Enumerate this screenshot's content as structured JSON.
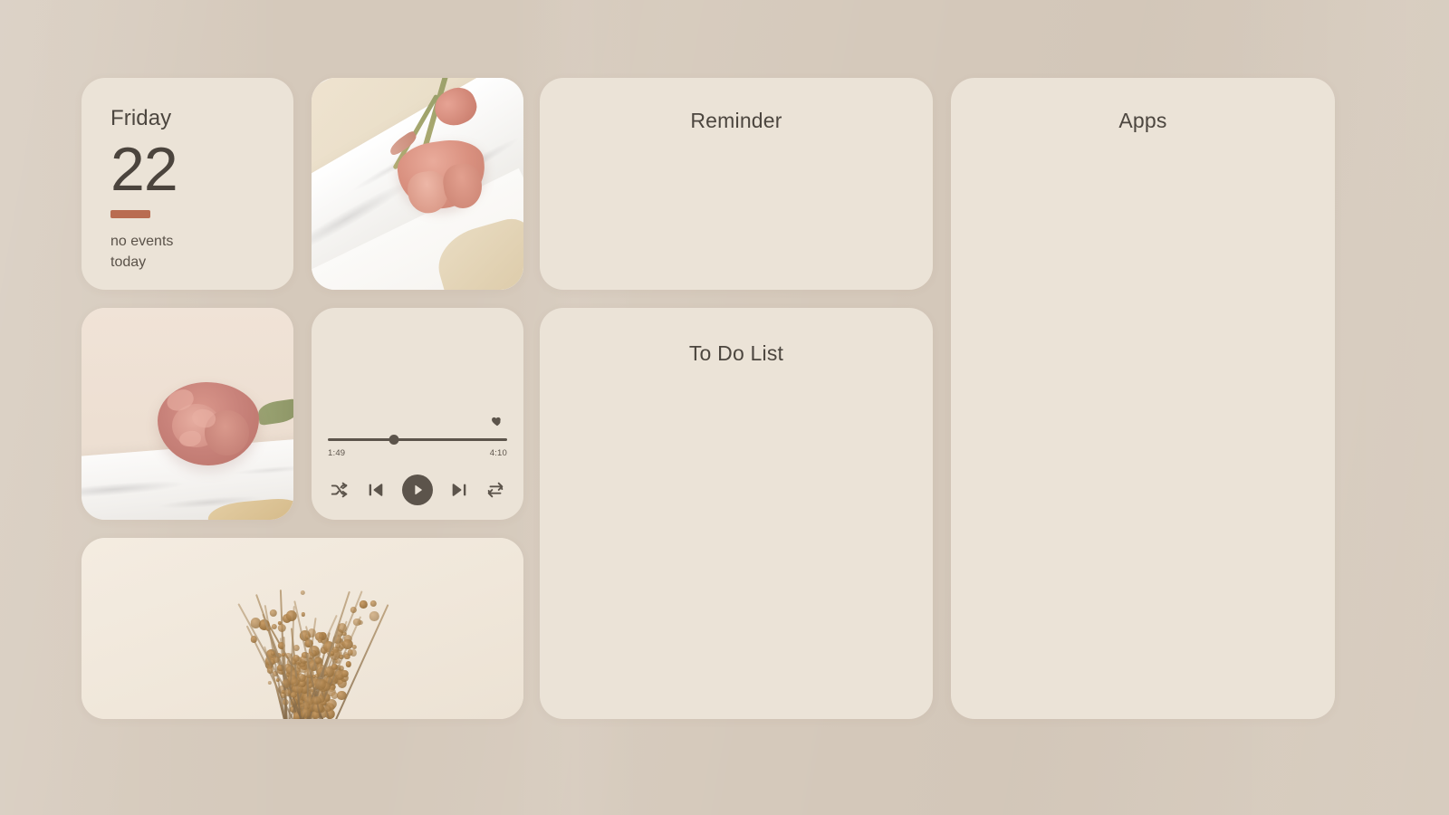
{
  "wallpaper": {
    "background_color": "#d5c9bb",
    "card_color": "#ebe3d7"
  },
  "calendar_widget": {
    "name": "calendar-widget",
    "weekday": "Friday",
    "day_number": "22",
    "accent_color": "#b96c51",
    "status_line_1": "no events",
    "status_line_2": "today"
  },
  "photo_tulips": {
    "name": "photo-widget-tulips",
    "alt": "pink tulips lying on a white marble slab over beige stone"
  },
  "photo_rose": {
    "name": "photo-widget-rose",
    "alt": "dusty pink peony rose resting on a white marble ledge"
  },
  "photo_dried": {
    "name": "photo-widget-dried-flowers",
    "alt": "bunch of dried brown gypsophila flowers on a cream background"
  },
  "music_player": {
    "name": "music-player-widget",
    "current_time": "1:49",
    "total_time": "4:10",
    "progress_percent": 37,
    "favorite": true,
    "controls": [
      {
        "id": "shuffle",
        "icon": "shuffle-icon",
        "label": "Shuffle"
      },
      {
        "id": "previous",
        "icon": "previous-icon",
        "label": "Previous track"
      },
      {
        "id": "play",
        "icon": "play-icon",
        "label": "Play"
      },
      {
        "id": "next",
        "icon": "next-icon",
        "label": "Next track"
      },
      {
        "id": "repeat",
        "icon": "repeat-icon",
        "label": "Repeat"
      }
    ]
  },
  "reminder_panel": {
    "name": "reminder-panel",
    "title": "Reminder",
    "items": []
  },
  "todo_panel": {
    "name": "todo-list-panel",
    "title": "To Do List",
    "items": []
  },
  "apps_panel": {
    "name": "apps-panel",
    "title": "Apps",
    "items": []
  }
}
